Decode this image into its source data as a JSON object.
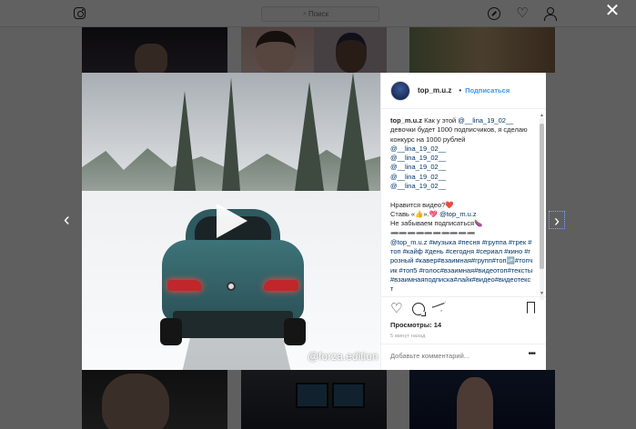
{
  "topbar": {
    "search_placeholder": "Поиск",
    "heart_glyph": "♡"
  },
  "controls": {
    "close_glyph": "✕",
    "prev_glyph": "‹",
    "next_glyph": "›"
  },
  "video": {
    "watermark": "@forza.edition"
  },
  "post": {
    "username": "top_m.u.z",
    "separator": "•",
    "follow_label": "Подписаться",
    "caption_lines": [
      {
        "kind": "wrap",
        "user": "top_m.u.z",
        "text": " Как у этой ",
        "tag": "@__lina_19_02__",
        "tail": " девочки будет 1000 подписчиков, я сделаю конкурс на 1000 рублей"
      },
      {
        "kind": "tag",
        "text": "@__lina_19_02__"
      },
      {
        "kind": "tag",
        "text": "@__lina_19_02__"
      },
      {
        "kind": "tag",
        "text": "@__lina_19_02__"
      },
      {
        "kind": "tag",
        "text": "@__lina_19_02__"
      },
      {
        "kind": "tag",
        "text": "@__lina_19_02__"
      },
      {
        "kind": "blank",
        "text": ""
      },
      {
        "kind": "text",
        "text": "Нравится видео?❤️"
      },
      {
        "kind": "mixed",
        "text": "Ставь «👍».💖 ",
        "tag": "@top_m.u.z"
      },
      {
        "kind": "text",
        "text": "Не забываем подписаться🍆"
      },
      {
        "kind": "text",
        "text": "➖➖➖➖➖➖➖➖➖➖"
      },
      {
        "kind": "wrap-tags",
        "text": "@top_m.u.z #музыка #песня #группа #трек #топ #кайф #день #сегодня #сериал #кино #грозный #кавер#взаимная#групп#топ🆙#топчик #топ5 #голос#взаимная#видеотоп#тексты#взаимнаяподписка#лайк#видео#видеотекст"
      }
    ],
    "views": "Просмотры: 14",
    "time": "5 минут назад",
    "comment_placeholder": "Добавьте комментарий...",
    "more_glyph": "•••",
    "heart_glyph": "♡"
  },
  "colors": {
    "accent": "#3897f0",
    "tag": "#003569"
  }
}
